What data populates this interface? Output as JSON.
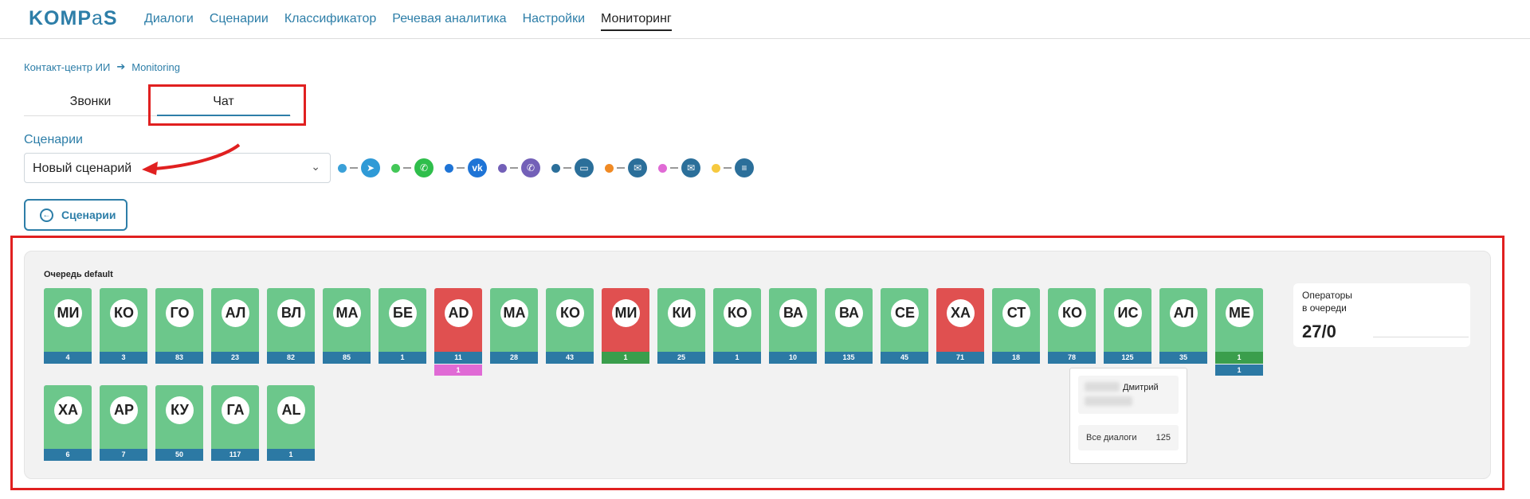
{
  "header": {
    "logo": "KOMPaS",
    "nav": [
      "Диалоги",
      "Сценарии",
      "Классификатор",
      "Речевая аналитика",
      "Настройки",
      "Мониторинг"
    ],
    "active_nav": "Мониторинг"
  },
  "breadcrumb": [
    "Контакт-центр ИИ",
    "Monitoring"
  ],
  "tabs": [
    "Звонки",
    "Чат"
  ],
  "active_tab": "Чат",
  "scenarios": {
    "label": "Сценарии",
    "selected": "Новый сценарий"
  },
  "channels": [
    {
      "name": "telegram",
      "dot": "#3aa0d8",
      "icon_bg": "#2f9ad6",
      "icon": "telegram-icon"
    },
    {
      "name": "whatsapp",
      "dot": "#43c757",
      "icon_bg": "#2fbe4b",
      "icon": "whatsapp-icon"
    },
    {
      "name": "vk",
      "dot": "#1e74d6",
      "icon_bg": "#1e74d6",
      "icon": "vk-icon"
    },
    {
      "name": "viber",
      "dot": "#7360b8",
      "icon_bg": "#7360b8",
      "icon": "viber-icon"
    },
    {
      "name": "webchat",
      "dot": "#2b6f9a",
      "icon_bg": "#2b6f9a",
      "icon": "chat-icon"
    },
    {
      "name": "chat2",
      "dot": "#f08a24",
      "icon_bg": "#2b6f9a",
      "icon": "speech-icon"
    },
    {
      "name": "email",
      "dot": "#e06ad5",
      "icon_bg": "#2b6f9a",
      "icon": "email-icon"
    },
    {
      "name": "form",
      "dot": "#f6c93f",
      "icon_bg": "#2b6f9a",
      "icon": "form-icon"
    }
  ],
  "back_button": "Сценарии",
  "queue": {
    "title": "Очередь default",
    "operators": [
      {
        "initials": "МИ",
        "count": "4",
        "status": "green"
      },
      {
        "initials": "КО",
        "count": "3",
        "status": "green"
      },
      {
        "initials": "ГО",
        "count": "83",
        "status": "green"
      },
      {
        "initials": "АЛ",
        "count": "23",
        "status": "green"
      },
      {
        "initials": "ВЛ",
        "count": "82",
        "status": "green"
      },
      {
        "initials": "МА",
        "count": "85",
        "status": "green"
      },
      {
        "initials": "БЕ",
        "count": "1",
        "status": "green"
      },
      {
        "initials": "AD",
        "count": "11",
        "status": "red",
        "extra": "1",
        "extra_color": "#e06ad5"
      },
      {
        "initials": "МА",
        "count": "28",
        "status": "green"
      },
      {
        "initials": "КО",
        "count": "43",
        "status": "green"
      },
      {
        "initials": "МИ",
        "count": "1",
        "status": "red",
        "count_color": "green"
      },
      {
        "initials": "КИ",
        "count": "25",
        "status": "green"
      },
      {
        "initials": "КО",
        "count": "1",
        "status": "green"
      },
      {
        "initials": "ВА",
        "count": "10",
        "status": "green"
      },
      {
        "initials": "ВА",
        "count": "135",
        "status": "green"
      },
      {
        "initials": "СЕ",
        "count": "45",
        "status": "green"
      },
      {
        "initials": "ХА",
        "count": "71",
        "status": "red"
      },
      {
        "initials": "СТ",
        "count": "18",
        "status": "green"
      },
      {
        "initials": "КО",
        "count": "78",
        "status": "green"
      },
      {
        "initials": "ИС",
        "count": "125",
        "status": "green"
      },
      {
        "initials": "АЛ",
        "count": "35",
        "status": "green"
      },
      {
        "initials": "МЕ",
        "count": "1",
        "status": "green",
        "count_color": "green",
        "extra": "1",
        "extra_color": "#2c79a4"
      },
      {
        "initials": "ХА",
        "count": "6",
        "status": "green"
      },
      {
        "initials": "АР",
        "count": "7",
        "status": "green"
      },
      {
        "initials": "КУ",
        "count": "50",
        "status": "green"
      },
      {
        "initials": "ГА",
        "count": "117",
        "status": "green"
      },
      {
        "initials": "AL",
        "count": "1",
        "status": "green"
      }
    ],
    "operators_label": "Операторы\nв очереди",
    "operators_value": "27/0"
  },
  "tooltip": {
    "first_name": "Дмитрий",
    "row_label": "Все диалоги",
    "row_value": "125"
  }
}
